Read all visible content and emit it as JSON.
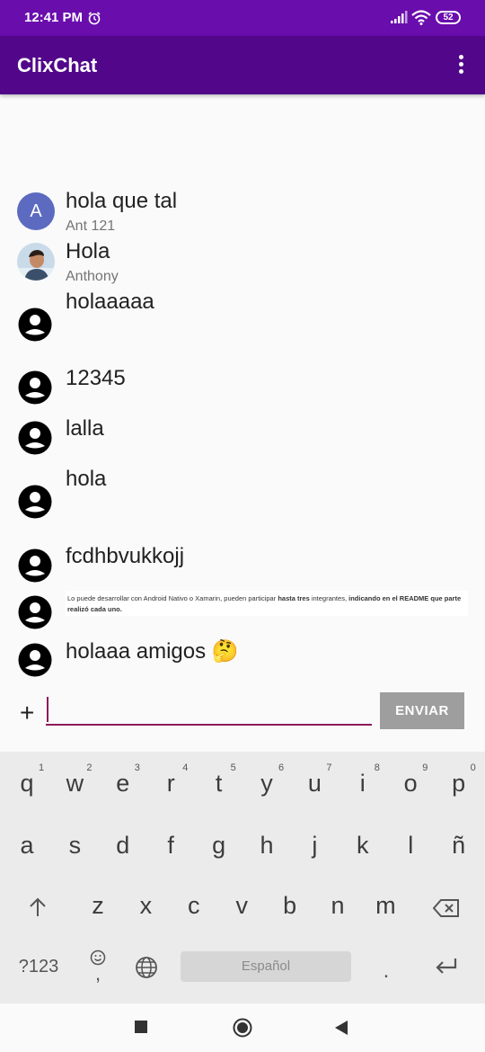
{
  "status_bar": {
    "time": "12:41 PM",
    "battery": "52"
  },
  "app_bar": {
    "title": "ClixChat"
  },
  "messages": [
    {
      "text": "hola que tal",
      "user": "Ant 121",
      "avatar_letter": "A"
    },
    {
      "text": "Hola",
      "user": "Anthony"
    },
    {
      "text": "holaaaaa"
    },
    {
      "text": "12345"
    },
    {
      "text": "lalla"
    },
    {
      "text": "hola"
    },
    {
      "text": "fcdhbvukkojj"
    },
    {
      "image_text_a": "Lo puede desarrollar con Android Nativo o Xamarin, pueden participar ",
      "image_text_b": "hasta tres",
      "image_text_c": " integrantes, ",
      "image_text_d": "indicando en el README que parte realizó cada uno."
    },
    {
      "text": "holaaa amigos 🤔"
    }
  ],
  "composer": {
    "plus": "+",
    "input_value": "",
    "send_label": "ENVIAR"
  },
  "keyboard": {
    "row1": [
      "q",
      "w",
      "e",
      "r",
      "t",
      "y",
      "u",
      "i",
      "o",
      "p"
    ],
    "row1_hints": [
      "1",
      "2",
      "3",
      "4",
      "5",
      "6",
      "7",
      "8",
      "9",
      "0"
    ],
    "row2": [
      "a",
      "s",
      "d",
      "f",
      "g",
      "h",
      "j",
      "k",
      "l",
      "ñ"
    ],
    "row3": [
      "z",
      "x",
      "c",
      "v",
      "b",
      "n",
      "m"
    ],
    "symbols_label": "?123",
    "comma": ",",
    "space_label": "Español",
    "period": "."
  },
  "colors": {
    "status_bar": "#6a0dad",
    "app_bar": "#52078a",
    "accent": "#8c1a5a",
    "avatar": "#5c6bc0"
  }
}
